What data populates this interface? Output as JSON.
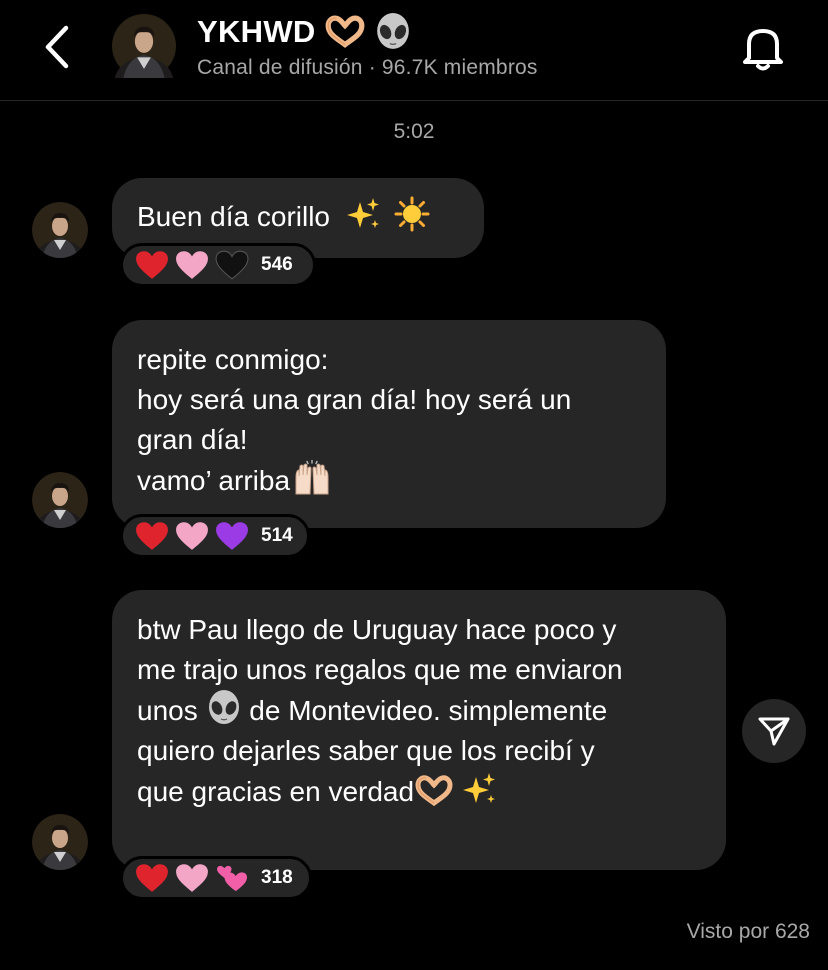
{
  "header": {
    "back_icon": "chevron-left-icon",
    "title": "YKHWD",
    "title_emojis": [
      "heart-hands-icon",
      "alien-icon"
    ],
    "subtitle_type": "Canal de difusión",
    "subtitle_separator": "·",
    "subtitle_members": "96.7K miembros",
    "bell_icon": "bell-icon"
  },
  "timestamp": "5:02",
  "messages": [
    {
      "text": "Buen día corillo",
      "trailing_emojis": [
        "sparkles-icon",
        "sun-icon"
      ],
      "reactions": [
        "red-heart",
        "pink-heart",
        "black-heart"
      ],
      "reaction_count": "546"
    },
    {
      "lines": [
        "repite conmigo:",
        "hoy será una gran día! hoy será un",
        "gran día!",
        "vamo’ arriba"
      ],
      "trailing_emojis": [
        "raised-hands-icon"
      ],
      "reactions": [
        "red-heart",
        "pink-heart",
        "purple-heart"
      ],
      "reaction_count": "514"
    },
    {
      "line1": "btw Pau llego de Uruguay hace poco y",
      "line2": "me trajo unos regalos que me enviaron",
      "line3_before": "unos ",
      "line3_after": " de Montevideo. simplemente",
      "line4": "quiero dejarles saber que los recibí y",
      "line5": "que gracias en verdad",
      "inline_emoji": "alien-icon",
      "trailing_emojis": [
        "heart-hands-icon",
        "sparkles-icon"
      ],
      "reactions": [
        "red-heart",
        "pink-heart",
        "two-hearts"
      ],
      "reaction_count": "318"
    }
  ],
  "share_icon": "paper-plane-icon",
  "seen_by": "Visto por 628",
  "colors": {
    "background": "#000000",
    "bubble": "#262626",
    "secondary_text": "#a8a8a8",
    "red_heart": "#e0242e",
    "pink_heart": "#f4a6c7",
    "purple_heart": "#9b3be6"
  }
}
